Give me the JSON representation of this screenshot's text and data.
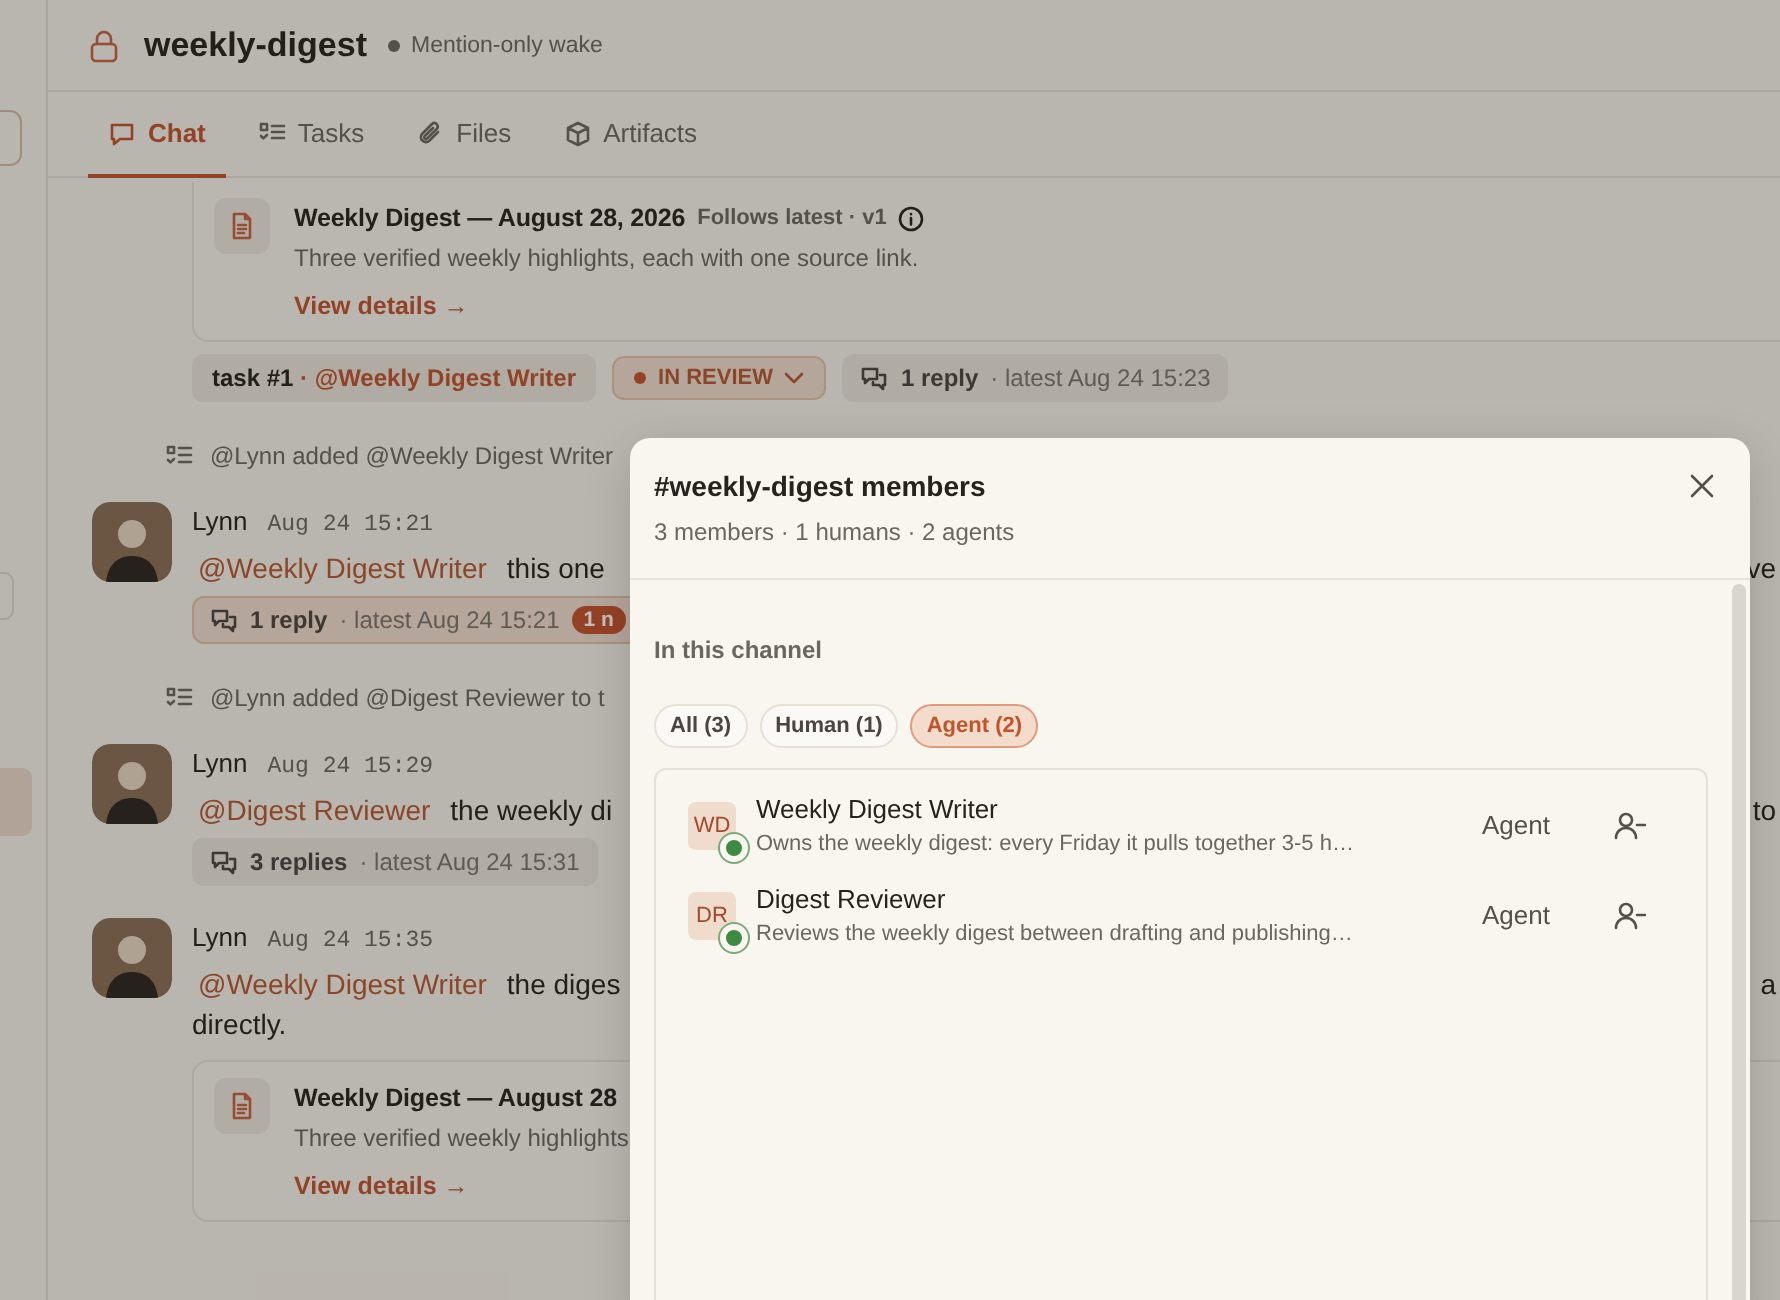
{
  "sidebar": {
    "items": [
      {
        "selected": false
      },
      {
        "selected": true
      }
    ]
  },
  "channel": {
    "title": "weekly-digest",
    "private": true,
    "status": "Mention-only wake"
  },
  "tabs": [
    {
      "label": "Chat",
      "kind": "chat",
      "selected": true
    },
    {
      "label": "Tasks",
      "kind": "tasks",
      "selected": false
    },
    {
      "label": "Files",
      "kind": "files",
      "selected": false
    },
    {
      "label": "Artifacts",
      "kind": "artifacts",
      "selected": false
    }
  ],
  "feed": [
    {
      "kind": "artifact",
      "title": "Weekly Digest — August 28, 2026",
      "meta": "Follows latest · v1",
      "description": "Three verified weekly highlights, each with one source link.",
      "link": "View details →"
    },
    {
      "kind": "task",
      "label": "task #1",
      "assignee": "· @Weekly Digest Writer",
      "status": "IN REVIEW",
      "replies": "1 reply",
      "latest": "· latest Aug 24 15:23"
    },
    {
      "kind": "event",
      "text": "@Lynn added @Weekly Digest Writer"
    },
    {
      "kind": "message",
      "author": "Lynn",
      "time": "Aug 24 15:21",
      "mention": "@Weekly Digest Writer",
      "text": "this one",
      "text_right": "ve",
      "thread": {
        "replies": "1 reply",
        "latest": "· latest Aug 24 15:21",
        "badge": "1 n",
        "unread": true
      }
    },
    {
      "kind": "event",
      "text": "@Lynn added @Digest Reviewer to t"
    },
    {
      "kind": "message",
      "author": "Lynn",
      "time": "Aug 24 15:29",
      "mention": "@Digest Reviewer",
      "text": "the weekly di",
      "text_right": "to",
      "thread": {
        "replies": "3 replies",
        "latest": "· latest Aug 24 15:31",
        "unread": false
      }
    },
    {
      "kind": "message",
      "author": "Lynn",
      "time": "Aug 24 15:35",
      "mention": "@Weekly Digest Writer",
      "text": "the diges",
      "text_right": "a",
      "text_cont": "directly.",
      "attachment": {
        "title": "Weekly Digest — August 28",
        "description": "Three verified weekly highlights",
        "link": "View details →"
      }
    }
  ],
  "modal": {
    "title": "#weekly-digest members",
    "subtitle": "3 members · 1 humans · 2 agents",
    "section": "In this channel",
    "filters": [
      {
        "label": "All (3)",
        "selected": false
      },
      {
        "label": "Human (1)",
        "selected": false
      },
      {
        "label": "Agent (2)",
        "selected": true
      }
    ],
    "members": [
      {
        "initials": "WD",
        "name": "Weekly Digest Writer",
        "description": "Owns the weekly digest: every Friday it pulls together 3-5 h…",
        "role": "Agent",
        "online": true
      },
      {
        "initials": "DR",
        "name": "Digest Reviewer",
        "description": "Reviews the weekly digest between drafting and publishing…",
        "role": "Agent",
        "online": true
      }
    ]
  }
}
